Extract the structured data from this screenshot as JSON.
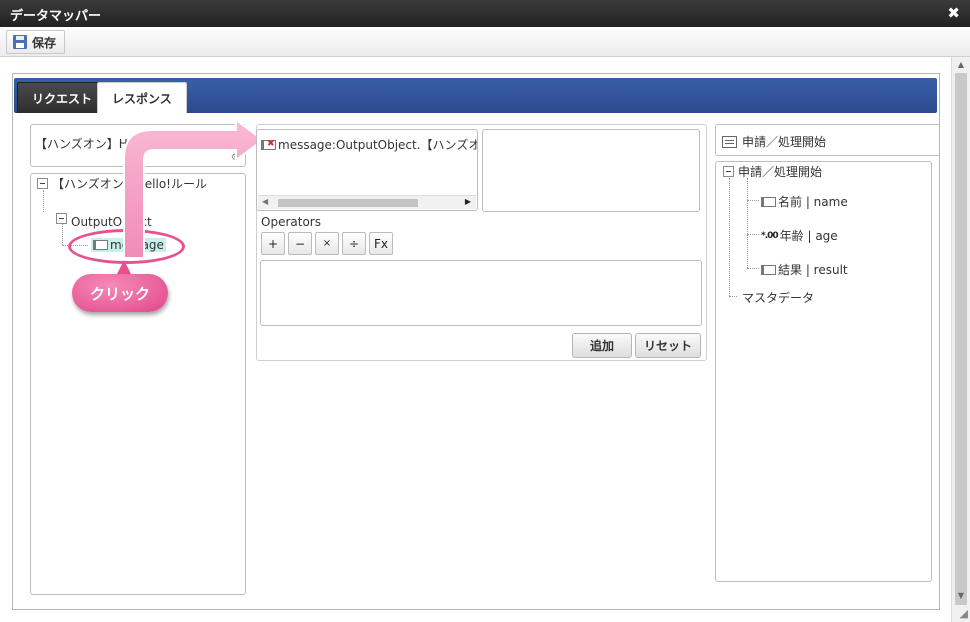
{
  "window": {
    "title": "データマッパー",
    "close_glyph": "✖"
  },
  "toolbar": {
    "save_label": "保存"
  },
  "tabs": [
    {
      "label": "リクエスト",
      "active": false
    },
    {
      "label": "レスポンス",
      "active": true
    }
  ],
  "source": {
    "header": "【ハンズオン】Hell",
    "gear_glyph": "⚙",
    "tree": {
      "root": "【ハンズオン】Hello!ルール",
      "child": "OutputObject",
      "leaf": "message"
    }
  },
  "callout": {
    "label": "クリック"
  },
  "mapping": {
    "item_text": "message:OutputObject.【ハンズオン】H",
    "operators_label": "Operators",
    "operators": [
      "+",
      "−",
      "×",
      "÷",
      "Fx"
    ],
    "add_label": "追加",
    "reset_label": "リセット"
  },
  "target": {
    "header": "申請／処理開始",
    "tree": {
      "root": "申請／処理開始",
      "fields": [
        {
          "label": "名前 | name",
          "icon": "field-icon"
        },
        {
          "label": "年齢 | age",
          "icon": "number-icon"
        },
        {
          "label": "結果 | result",
          "icon": "field-icon"
        }
      ],
      "master": "マスタデータ"
    }
  },
  "colors": {
    "accent": "#2e4f92",
    "callout": "#e8508f",
    "highlight": "#c7f0ec"
  }
}
